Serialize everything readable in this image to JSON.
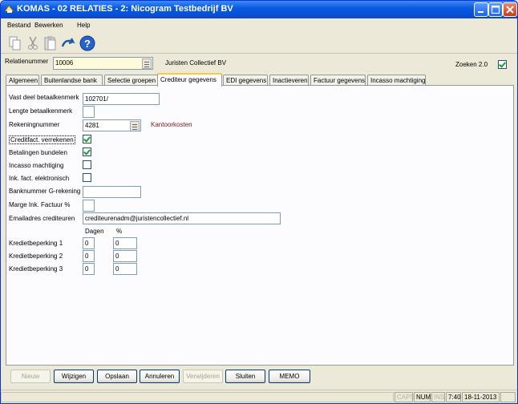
{
  "window": {
    "title": "KOMAS - 02 RELATIES - 2: Nicogram Testbedrijf BV"
  },
  "menu": {
    "items": [
      "Bestand",
      "Bewerken",
      "Help"
    ]
  },
  "toolbar": {
    "icons": [
      "copy-icon",
      "cut-icon",
      "paste-icon",
      "undo-icon",
      "help-icon"
    ]
  },
  "header": {
    "relatienummer_label": "Relatienummer",
    "relatienummer_value": "10006",
    "relatie_naam": "Juristen Collectief BV",
    "zoeken_label": "Zoeken 2.0",
    "zoeken_checked": true
  },
  "tabs": [
    {
      "label": "Algemeen",
      "active": false
    },
    {
      "label": "Buitenlandse bank",
      "active": false
    },
    {
      "label": "Selectie groepen",
      "active": false
    },
    {
      "label": "Crediteur gegevens",
      "active": true
    },
    {
      "label": "EDI gegevens",
      "active": false
    },
    {
      "label": "Inactieveren",
      "active": false
    },
    {
      "label": "Factuur gegevens",
      "active": false
    },
    {
      "label": "Incasso machtiging",
      "active": false
    }
  ],
  "form": {
    "vast_deel_label": "Vast deel betaalkenmerk",
    "vast_deel_value": "102701/",
    "lengte_label": "Lengte betaalkenmerk",
    "lengte_value": "",
    "rekeningnummer_label": "Rekeningnummer",
    "rekeningnummer_value": "4281",
    "rekening_omschrijving": "Kantoorkosten",
    "creditfact_label": "Creditfact. verrekenen",
    "creditfact_checked": true,
    "betalingen_label": "Betalingen bundelen",
    "betalingen_checked": true,
    "incasso_label": "Incasso machtiging",
    "incasso_checked": false,
    "ink_fact_label": "Ink. fact. elektronisch",
    "ink_fact_checked": false,
    "banknummer_label": "Banknummer G-rekening",
    "banknummer_value": "",
    "marge_label": "Marge Ink. Factuur %",
    "marge_value": "",
    "email_label": "Emailadres crediteuren",
    "email_value": "crediteurenadm@juristencollectief.nl",
    "dagen_header": "Dagen",
    "percent_header": "%",
    "kredietbeperkingen": [
      {
        "label": "Kredietbeperking 1",
        "dagen": "0",
        "percent": "0"
      },
      {
        "label": "Kredietbeperking 2",
        "dagen": "0",
        "percent": "0"
      },
      {
        "label": "Kredietbeperking 3",
        "dagen": "0",
        "percent": "0"
      }
    ]
  },
  "buttons": [
    {
      "label": "Nieuw",
      "enabled": false
    },
    {
      "label": "Wijzigen",
      "enabled": true
    },
    {
      "label": "Opslaan",
      "enabled": true
    },
    {
      "label": "Annuleren",
      "enabled": true
    },
    {
      "label": "Verwijderen",
      "enabled": false
    },
    {
      "label": "Sluiten",
      "enabled": true
    },
    {
      "label": "MEMO",
      "enabled": true
    }
  ],
  "status": {
    "caps": "CAPS",
    "num": "NUM",
    "ins": "INS",
    "time": "7:40",
    "date": "18-11-2013"
  }
}
